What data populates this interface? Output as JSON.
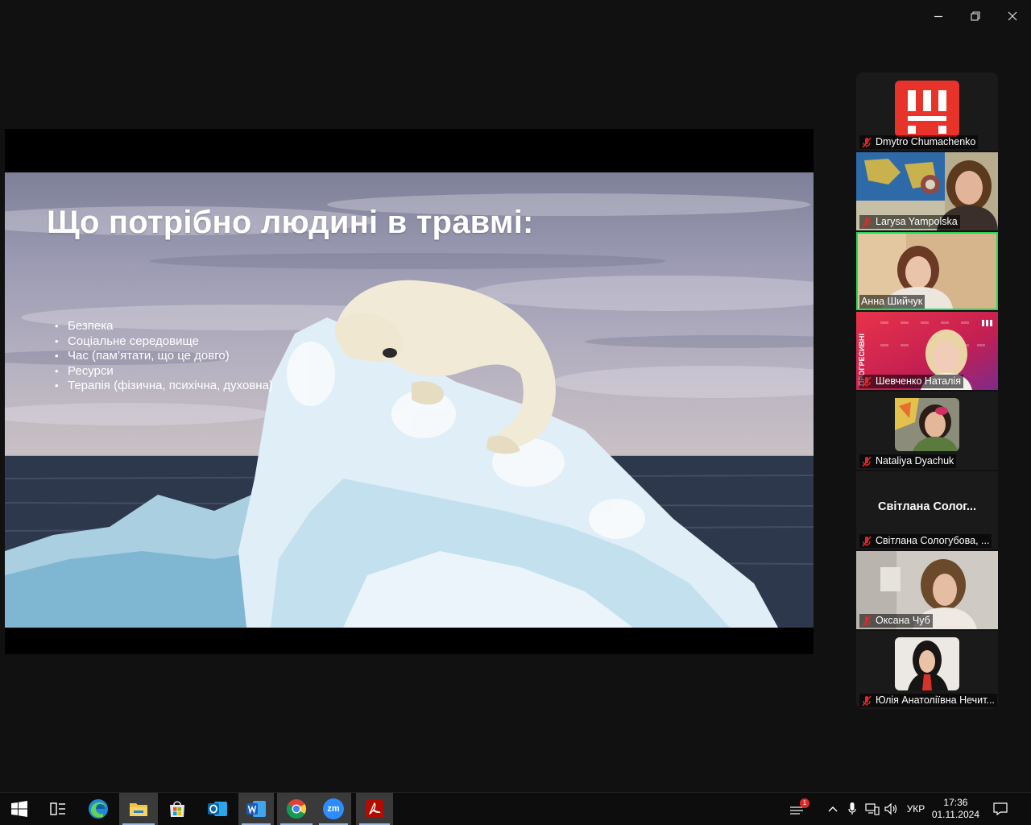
{
  "window": {
    "controls": {
      "minimize": "minimize-icon",
      "restore": "restore-icon",
      "close": "close-icon"
    }
  },
  "slide": {
    "title": "Що потрібно людині в травмі:",
    "bullets": [
      "Безпека",
      "Соціальне середовище",
      "Час (пам’ятати, що це довго)",
      "Ресурси",
      "Терапія (фізична, психічна, духовна)"
    ]
  },
  "participants": [
    {
      "name": "Dmytro Chumachenko",
      "muted": true,
      "video": "logo",
      "logo_text": "!!!",
      "logo_color": "#e8332a"
    },
    {
      "name": "Larysa Yampolska",
      "muted": true,
      "video": "camera"
    },
    {
      "name": "Анна Шийчук",
      "muted": false,
      "video": "camera",
      "active_speaker": true
    },
    {
      "name": "Шевченко Наталія",
      "muted": true,
      "video": "camera",
      "banner_text": "ПРОГРЕСИВНІ"
    },
    {
      "name": "Nataliya Dyachuk",
      "muted": true,
      "video": "avatar"
    },
    {
      "name": "Світлана Сологубова, ...",
      "display_name": "Світлана Солог...",
      "muted": true,
      "video": "off"
    },
    {
      "name": "Оксана Чуб",
      "muted": true,
      "video": "camera"
    },
    {
      "name": "Юлія Анатоліївна Нечит...",
      "muted": true,
      "video": "avatar"
    }
  ],
  "colors": {
    "active_speaker_border": "#23d959",
    "muted_mic": "#e02828",
    "zoom_blue": "#2d8cff"
  },
  "taskbar": {
    "apps": [
      "windows-start-icon",
      "task-view-icon",
      "edge-icon",
      "file-explorer-icon",
      "store-icon",
      "outlook-icon",
      "word-icon",
      "chrome-icon",
      "zoom-icon",
      "acrobat-icon"
    ],
    "zoom_label": "zm",
    "notification_count": "1",
    "language": "УКР",
    "time": "17:36",
    "date": "01.11.2024"
  }
}
